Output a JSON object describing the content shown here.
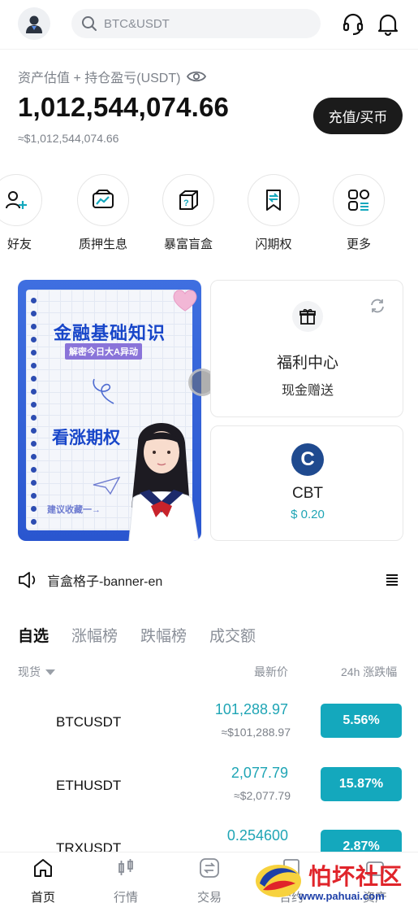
{
  "header": {
    "search_placeholder": "BTC&USDT",
    "avatar_icon": "user-avatar-icon",
    "support_icon": "headset-icon",
    "notification_icon": "bell-icon"
  },
  "assets": {
    "label": "资产估值 + 持仓盈亏(USDT)",
    "value": "1,012,544,074.66",
    "approx": "≈$1,012,544,074.66",
    "deposit_button": "充值/买币"
  },
  "quick_actions": [
    {
      "label": "好友",
      "icon": "invite-friend-icon"
    },
    {
      "label": "质押生息",
      "icon": "staking-icon"
    },
    {
      "label": "暴富盲盒",
      "icon": "blind-box-icon"
    },
    {
      "label": "闪期权",
      "icon": "flash-option-icon"
    },
    {
      "label": "更多",
      "icon": "more-grid-icon"
    }
  ],
  "banner": {
    "title": "金融基础知识",
    "subtitle": "解密今日大A异动",
    "headline": "看涨期权",
    "footer": "建议收藏一→"
  },
  "welfare_card": {
    "title": "福利中心",
    "subtitle": "现金赠送"
  },
  "cbt_card": {
    "logo_letter": "C",
    "name": "CBT",
    "price": "$ 0.20"
  },
  "notice": {
    "text": "盲盒格子-banner-en"
  },
  "market_tabs": [
    "自选",
    "涨幅榜",
    "跌幅榜",
    "成交额"
  ],
  "columns": {
    "spot": "现货",
    "last_price": "最新价",
    "change_24h": "24h 涨跌幅"
  },
  "market_rows": [
    {
      "symbol": "BTCUSDT",
      "price": "101,288.97",
      "fiat": "≈$101,288.97",
      "change": "5.56%"
    },
    {
      "symbol": "ETHUSDT",
      "price": "2,077.79",
      "fiat": "≈$2,077.79",
      "change": "15.87%"
    },
    {
      "symbol": "TRXUSDT",
      "price": "0.254600",
      "fiat": "",
      "change": "2.87%"
    }
  ],
  "bottom_nav": [
    {
      "label": "首页",
      "icon": "home-icon"
    },
    {
      "label": "行情",
      "icon": "market-candles-icon"
    },
    {
      "label": "交易",
      "icon": "trade-swap-icon"
    },
    {
      "label": "合约",
      "icon": "contract-icon"
    },
    {
      "label": "资产",
      "icon": "wallet-icon"
    }
  ],
  "watermark": {
    "title": "怕坏社区",
    "url": "www.pahuai.com"
  },
  "colors": {
    "accent_teal": "#14a8bd",
    "price_teal": "#1fa5b5",
    "dark_button": "#1b1b1b",
    "banner_blue": "#2a56cf"
  }
}
